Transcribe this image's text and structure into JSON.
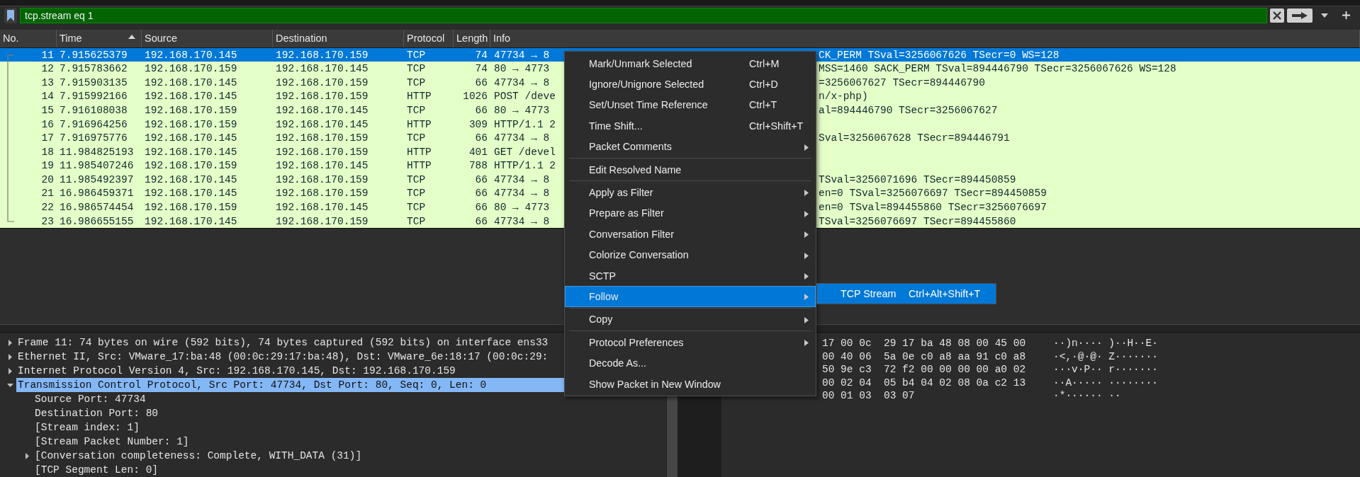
{
  "filter": {
    "value": "tcp.stream eq 1"
  },
  "packet_list": {
    "columns": [
      {
        "label": "No.",
        "sorted": false
      },
      {
        "label": "Time",
        "sorted": true
      },
      {
        "label": "Source",
        "sorted": false
      },
      {
        "label": "Destination",
        "sorted": false
      },
      {
        "label": "Protocol",
        "sorted": false
      },
      {
        "label": "Length",
        "sorted": false
      },
      {
        "label": "Info",
        "sorted": false
      }
    ],
    "rows": [
      {
        "no": "11",
        "time": "7.915625379",
        "source": "192.168.170.145",
        "destination": "192.168.170.159",
        "protocol": "TCP",
        "length": "74",
        "info": "47734 → 8",
        "info_tail": "CK_PERM TSval=3256067626 TSecr=0 WS=128",
        "selected": true
      },
      {
        "no": "12",
        "time": "7.915783662",
        "source": "192.168.170.159",
        "destination": "192.168.170.145",
        "protocol": "TCP",
        "length": "74",
        "info": "80 → 4773",
        "info_tail": "MSS=1460 SACK_PERM TSval=894446790 TSecr=3256067626 WS=128",
        "selected": false
      },
      {
        "no": "13",
        "time": "7.915903135",
        "source": "192.168.170.145",
        "destination": "192.168.170.159",
        "protocol": "TCP",
        "length": "66",
        "info": "47734 → 8",
        "info_tail": "=3256067627 TSecr=894446790",
        "selected": false
      },
      {
        "no": "14",
        "time": "7.915992166",
        "source": "192.168.170.145",
        "destination": "192.168.170.159",
        "protocol": "HTTP",
        "length": "1026",
        "info": "POST /deve",
        "info_tail": "n/x-php)",
        "selected": false
      },
      {
        "no": "15",
        "time": "7.916108038",
        "source": "192.168.170.159",
        "destination": "192.168.170.145",
        "protocol": "TCP",
        "length": "66",
        "info": "80 → 4773",
        "info_tail": "al=894446790 TSecr=3256067627",
        "selected": false
      },
      {
        "no": "16",
        "time": "7.916964256",
        "source": "192.168.170.159",
        "destination": "192.168.170.145",
        "protocol": "HTTP",
        "length": "309",
        "info": "HTTP/1.1 2",
        "selected": false
      },
      {
        "no": "17",
        "time": "7.916975776",
        "source": "192.168.170.145",
        "destination": "192.168.170.159",
        "protocol": "TCP",
        "length": "66",
        "info": "47734 → 8",
        "info_tail": "Sval=3256067628 TSecr=894446791",
        "selected": false
      },
      {
        "no": "18",
        "time": "11.984825193",
        "source": "192.168.170.145",
        "destination": "192.168.170.159",
        "protocol": "HTTP",
        "length": "401",
        "info": "GET /devel",
        "selected": false
      },
      {
        "no": "19",
        "time": "11.985407246",
        "source": "192.168.170.159",
        "destination": "192.168.170.145",
        "protocol": "HTTP",
        "length": "788",
        "info": "HTTP/1.1 2",
        "selected": false
      },
      {
        "no": "20",
        "time": "11.985492397",
        "source": "192.168.170.145",
        "destination": "192.168.170.159",
        "protocol": "TCP",
        "length": "66",
        "info": "47734 → 8",
        "info_tail": "TSval=3256071696 TSecr=894450859",
        "selected": false
      },
      {
        "no": "21",
        "time": "16.986459371",
        "source": "192.168.170.145",
        "destination": "192.168.170.159",
        "protocol": "TCP",
        "length": "66",
        "info": "47734 → 8",
        "info_tail": "en=0 TSval=3256076697 TSecr=894450859",
        "selected": false
      },
      {
        "no": "22",
        "time": "16.986574454",
        "source": "192.168.170.159",
        "destination": "192.168.170.145",
        "protocol": "TCP",
        "length": "66",
        "info": "80 → 4773",
        "info_tail": "en=0 TSval=894455860 TSecr=3256076697",
        "selected": false
      },
      {
        "no": "23",
        "time": "16.986655155",
        "source": "192.168.170.145",
        "destination": "192.168.170.159",
        "protocol": "TCP",
        "length": "66",
        "info": "47734 → 8",
        "info_tail": "TSval=3256076697 TSecr=894455860",
        "selected": false
      }
    ]
  },
  "details": [
    {
      "text": "Frame 11: 74 bytes on wire (592 bits), 74 bytes captured (592 bits) on interface ens33",
      "expanded": false,
      "selected": false
    },
    {
      "text": "Ethernet II, Src: VMware_17:ba:48 (00:0c:29:17:ba:48), Dst: VMware_6e:18:17 (00:0c:29:",
      "expanded": false,
      "selected": false
    },
    {
      "text": "Internet Protocol Version 4, Src: 192.168.170.145, Dst: 192.168.170.159",
      "expanded": false,
      "selected": false
    },
    {
      "text": "Transmission Control Protocol, Src Port: 47734, Dst Port: 80, Seq: 0, Len: 0",
      "expanded": true,
      "selected": true,
      "children": [
        {
          "text": "Source Port: 47734",
          "selected": false
        },
        {
          "text": "Destination Port: 80",
          "selected": false
        },
        {
          "text": "[Stream index: 1]",
          "selected": false
        },
        {
          "text": "[Stream Packet Number: 1]",
          "selected": false
        },
        {
          "text": "[Conversation completeness: Complete, WITH_DATA (31)]",
          "expanded": false,
          "selected": false
        },
        {
          "text": "[TCP Segment Len: 0]",
          "selected": false
        }
      ]
    }
  ],
  "bytes": [
    {
      "hex": "17 00 0c  29 17 ba 48 08 00 45 00",
      "ascii": "··)n···· )··H··E·"
    },
    {
      "hex": "00 40 06  5a 0e c0 a8 aa 91 c0 a8",
      "ascii": "·<,·@·@· Z·······"
    },
    {
      "hex": "50 9e c3  72 f2 00 00 00 00 a0 02",
      "ascii": "···v·P·· r·······"
    },
    {
      "hex": "00 02 04  05 b4 04 02 08 0a c2 13",
      "ascii": "··A····· ········"
    },
    {
      "hex": "00 01 03  03 07",
      "ascii": "·*······ ··"
    }
  ],
  "context_menu": {
    "items": [
      {
        "kind": "item",
        "label": "Mark/Unmark Selected",
        "shortcut": "Ctrl+M",
        "submenu": false,
        "selected": false
      },
      {
        "kind": "item",
        "label": "Ignore/Unignore Selected",
        "shortcut": "Ctrl+D",
        "submenu": false,
        "selected": false
      },
      {
        "kind": "item",
        "label": "Set/Unset Time Reference",
        "shortcut": "Ctrl+T",
        "submenu": false,
        "selected": false
      },
      {
        "kind": "item",
        "label": "Time Shift...",
        "shortcut": "Ctrl+Shift+T",
        "submenu": false,
        "selected": false
      },
      {
        "kind": "item",
        "label": "Packet Comments",
        "submenu": true,
        "selected": false
      },
      {
        "kind": "separator"
      },
      {
        "kind": "item",
        "label": "Edit Resolved Name",
        "submenu": false,
        "selected": false
      },
      {
        "kind": "separator"
      },
      {
        "kind": "item",
        "label": "Apply as Filter",
        "submenu": true,
        "selected": false
      },
      {
        "kind": "item",
        "label": "Prepare as Filter",
        "submenu": true,
        "selected": false
      },
      {
        "kind": "item",
        "label": "Conversation Filter",
        "submenu": true,
        "selected": false
      },
      {
        "kind": "item",
        "label": "Colorize Conversation",
        "submenu": true,
        "selected": false
      },
      {
        "kind": "item",
        "label": "SCTP",
        "submenu": true,
        "selected": false
      },
      {
        "kind": "item",
        "label": "Follow",
        "submenu": true,
        "selected": true
      },
      {
        "kind": "separator"
      },
      {
        "kind": "item",
        "label": "Copy",
        "submenu": true,
        "selected": false
      },
      {
        "kind": "separator"
      },
      {
        "kind": "item",
        "label": "Protocol Preferences",
        "submenu": true,
        "selected": false
      },
      {
        "kind": "item",
        "label": "Decode As...",
        "submenu": false,
        "selected": false
      },
      {
        "kind": "item",
        "label": "Show Packet in New Window",
        "submenu": false,
        "selected": false
      }
    ]
  },
  "submenu": {
    "items": [
      {
        "label": "TCP Stream",
        "shortcut": "Ctrl+Alt+Shift+T",
        "selected": true
      }
    ]
  }
}
